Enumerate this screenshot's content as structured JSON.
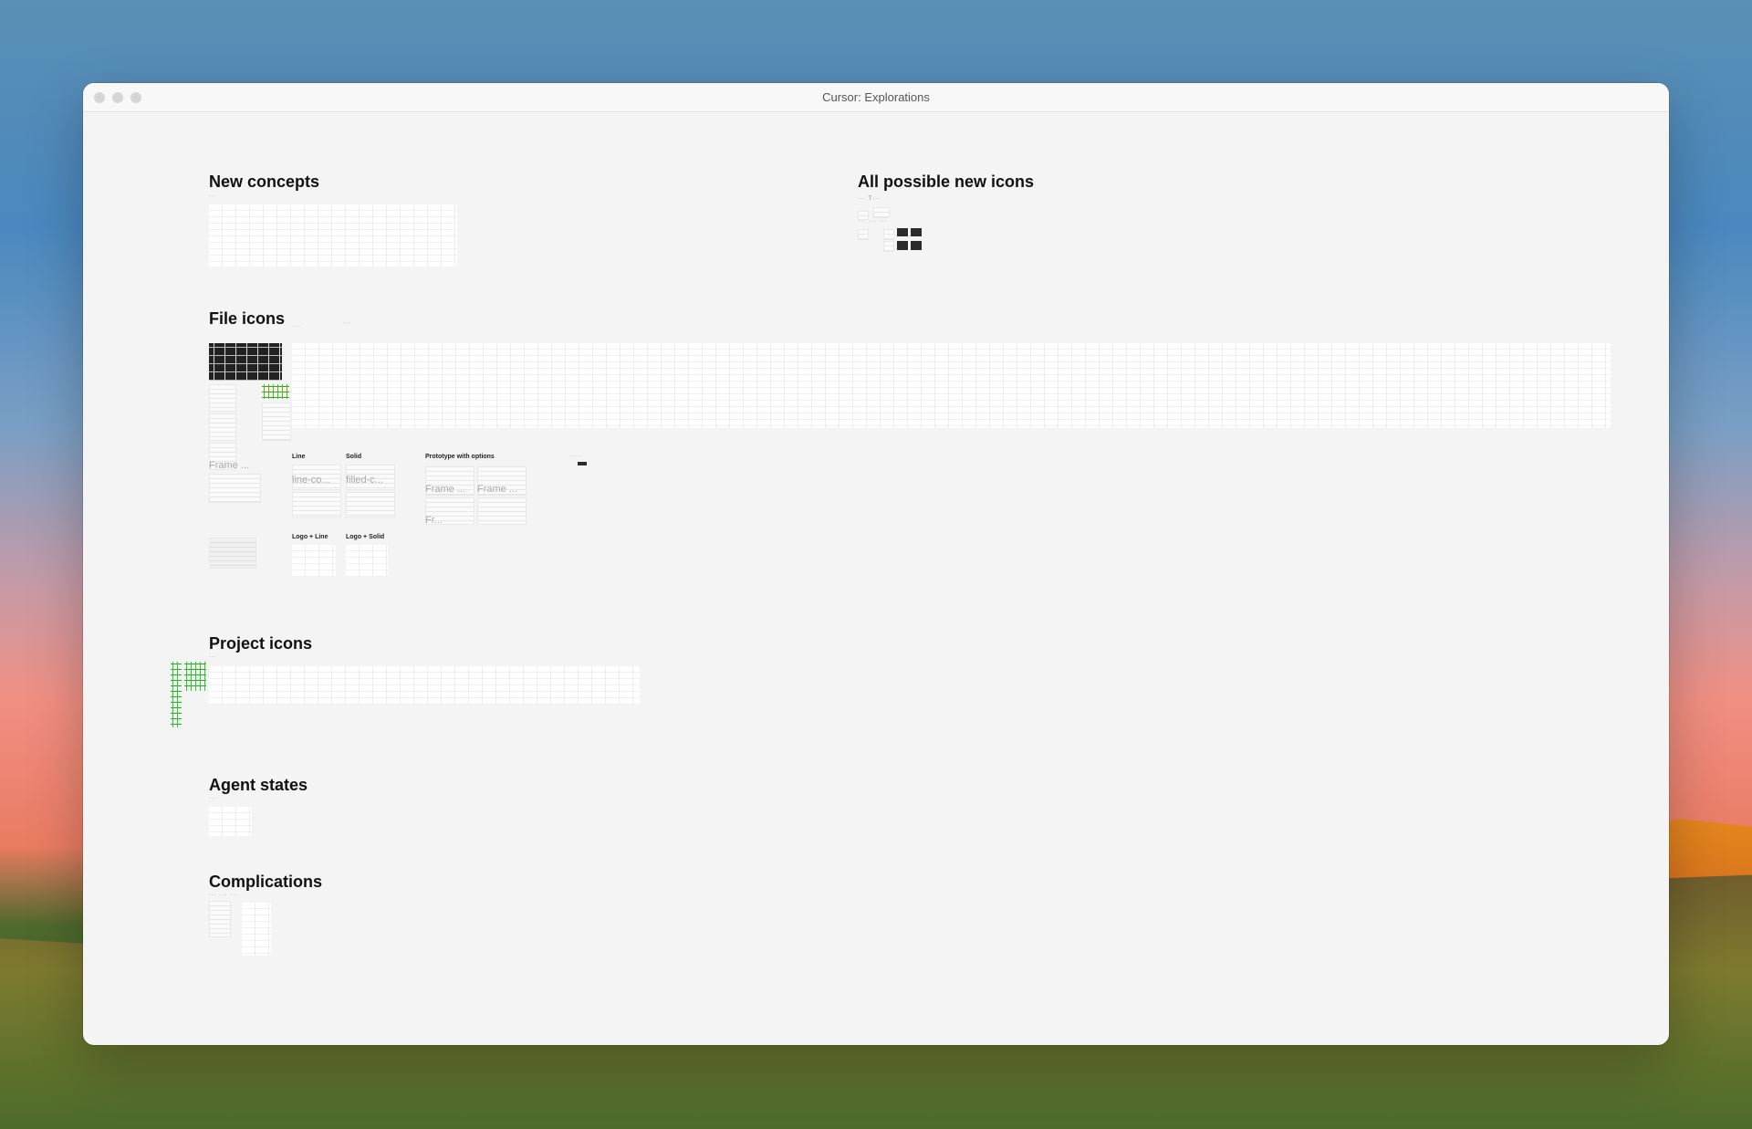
{
  "window": {
    "title": "Cursor: Explorations"
  },
  "sections": {
    "new_concepts": "New concepts",
    "all_icons": "All possible new icons",
    "file_icons": "File icons",
    "project_icons": "Project icons",
    "agent_states": "Agent states",
    "complications": "Complications"
  },
  "file_icons_labels": {
    "line": "Line",
    "solid": "Solid",
    "prototype": "Prototype with options",
    "logo_line": "Logo + Line",
    "logo_solid": "Logo + Solid",
    "frame_1": "Frame ...",
    "frame_2": "Frame ...",
    "frame_3": "Frame ...",
    "frame_4": "Fr...",
    "line_co": "line-co...",
    "filled_c": "filled-c..."
  },
  "icons": {
    "traffic": [
      "window-close-icon",
      "window-minimize-icon",
      "window-zoom-icon"
    ]
  }
}
